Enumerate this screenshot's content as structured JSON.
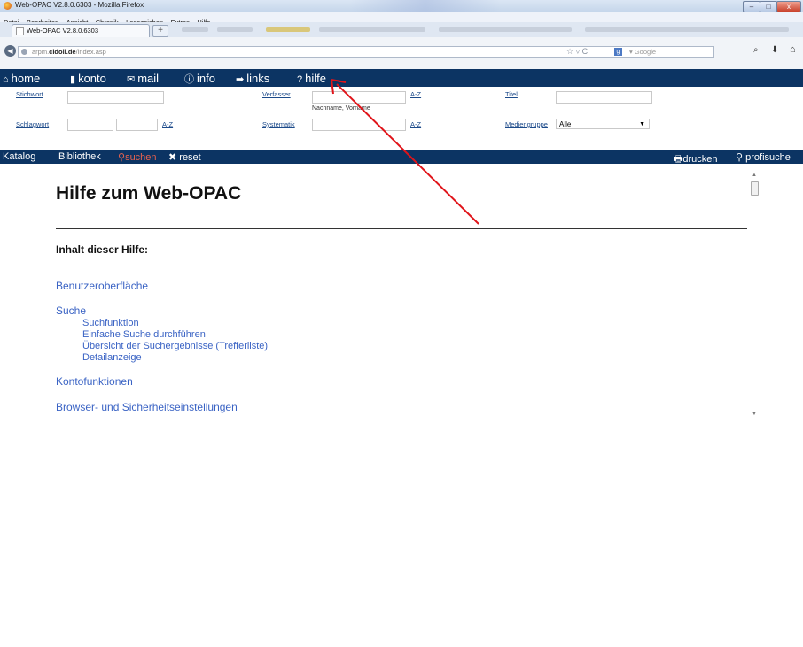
{
  "window": {
    "title": "Web-OPAC V2.8.0.6303 - Mozilla Firefox",
    "minimize_glyph": "–",
    "maximize_glyph": "□",
    "close_glyph": "x"
  },
  "menu": [
    "Datei",
    "Bearbeiten",
    "Ansicht",
    "Chronik",
    "Lesezeichen",
    "Extras",
    "Hilfe"
  ],
  "tab": {
    "label": "Web-OPAC V2.8.0.6303",
    "new_tab": "+"
  },
  "nav": {
    "back": "◀",
    "url_prefix": "arpm.",
    "url_domain": "cidoli.de",
    "url_path": "/index.asp",
    "star": "☆ ▿ C",
    "search_engine": "g",
    "search_placeholder": "▾ Google",
    "search_icon": "⌕",
    "download_icon": "⬇",
    "home_icon": "⌂"
  },
  "opac_nav": [
    {
      "icon": "⌂",
      "label": "home"
    },
    {
      "icon": "▮",
      "label": "konto"
    },
    {
      "icon": "✉",
      "label": "mail"
    },
    {
      "icon": "ⓘ",
      "label": "info"
    },
    {
      "icon": "➡",
      "label": "links"
    },
    {
      "icon": "?",
      "label": "hilfe"
    }
  ],
  "form": {
    "stichwort": "Stichwort",
    "schlagwort": "Schlagwort",
    "verfasser": "Verfasser",
    "systematik": "Systematik",
    "titel": "Titel",
    "mediengruppe": "Mediengruppe",
    "az": "A-Z",
    "name_hint": "Nachname, Vorname",
    "mediengruppe_value": "Alle",
    "select_arrow": "▼"
  },
  "bar2": {
    "katalog": "Katalog",
    "bibliothek": "Bibliothek",
    "suchen_icon": "⚲",
    "suchen": "suchen",
    "reset_icon": "✖",
    "reset": "reset",
    "drucken_icon": "🖶",
    "drucken": "drucken",
    "profisuche_icon": "⚲",
    "profisuche": "profisuche"
  },
  "content": {
    "title": "Hilfe zum Web-OPAC",
    "toc_heading": "Inhalt dieser Hilfe:",
    "toc": [
      {
        "label": "Benutzeroberfläche",
        "sub": []
      },
      {
        "label": "Suche",
        "sub": [
          "Suchfunktion",
          "Einfache Suche durchführen",
          "Übersicht der Suchergebnisse (Trefferliste)",
          "Detailanzeige"
        ]
      },
      {
        "label": "Kontofunktionen",
        "sub": []
      },
      {
        "label": "Browser- und Sicherheitseinstellungen",
        "sub": []
      }
    ],
    "scroll_up": "▲",
    "scroll_down": "▼"
  },
  "colors": {
    "navy": "#0c3463",
    "link": "#3a63c4",
    "label": "#1c4a8a",
    "suchen": "#e8624e",
    "annotation": "#e0141a"
  }
}
